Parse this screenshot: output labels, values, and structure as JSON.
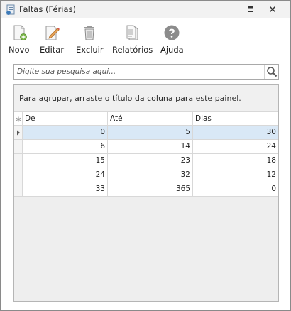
{
  "window": {
    "title": "Faltas (Férias)",
    "restore_icon": "restore-icon",
    "close_icon": "close-icon"
  },
  "toolbar": {
    "items": [
      {
        "label": "Novo",
        "icon": "new-document-icon"
      },
      {
        "label": "Editar",
        "icon": "edit-pencil-icon"
      },
      {
        "label": "Excluir",
        "icon": "trash-icon"
      },
      {
        "label": "Relatórios",
        "icon": "report-icon"
      },
      {
        "label": "Ajuda",
        "icon": "help-icon"
      }
    ]
  },
  "search": {
    "placeholder": "Digite sua pesquisa aqui...",
    "value": "",
    "icon": "search-icon"
  },
  "grid": {
    "group_panel_text": "Para agrupar, arraste o título da coluna para este painel.",
    "indicator_header": "*",
    "columns": [
      "De",
      "Até",
      "Dias"
    ],
    "rows": [
      {
        "de": "0",
        "ate": "5",
        "dias": "30",
        "selected": true
      },
      {
        "de": "6",
        "ate": "14",
        "dias": "24",
        "selected": false
      },
      {
        "de": "15",
        "ate": "23",
        "dias": "18",
        "selected": false
      },
      {
        "de": "24",
        "ate": "32",
        "dias": "12",
        "selected": false
      },
      {
        "de": "33",
        "ate": "365",
        "dias": "0",
        "selected": false
      }
    ]
  },
  "colors": {
    "selected_row": "#d9e8f6",
    "help_icon": "#8c8c8c"
  }
}
